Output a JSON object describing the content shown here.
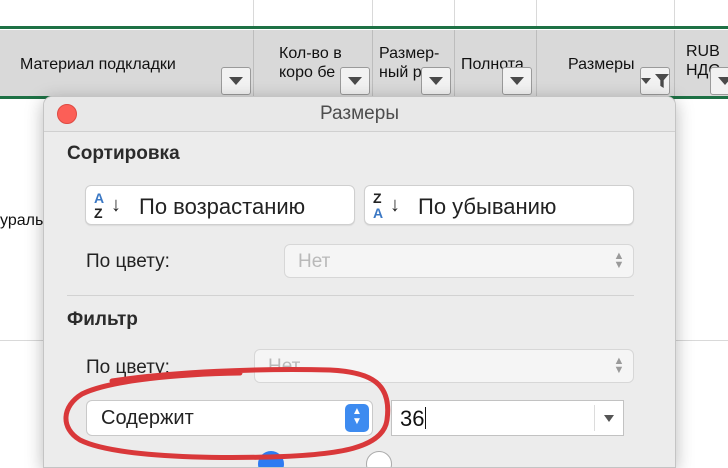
{
  "spreadsheet": {
    "headers": [
      {
        "label": "Материал подкладки",
        "button": "dropdown"
      },
      {
        "label": "Кол-во в\nкоро бе",
        "button": "dropdown"
      },
      {
        "label": "Размер-\nный р",
        "button": "dropdown"
      },
      {
        "label": "Полнота",
        "button": "dropdown"
      },
      {
        "label": "Размеры",
        "button": "filter-active"
      },
      {
        "label": "RUB\nНДС",
        "button": "dropdown"
      }
    ],
    "cell_text": "ураль"
  },
  "popup": {
    "title": "Размеры",
    "sort": {
      "heading": "Сортировка",
      "ascending_label": "По возрастанию",
      "ascending_icon": {
        "top": "A",
        "bottom": "Z",
        "arrow": "↓"
      },
      "descending_label": "По убыванию",
      "descending_icon": {
        "top": "Z",
        "bottom": "A",
        "arrow": "↓"
      },
      "by_color_label": "По цвету:",
      "by_color_value": "Нет"
    },
    "filter": {
      "heading": "Фильтр",
      "by_color_label": "По цвету:",
      "by_color_value": "Нет",
      "condition_value": "Содержит",
      "criteria_value": "36"
    }
  },
  "colors": {
    "header_bg": "#d9d9d9",
    "excel_green": "#1e7145",
    "close_red": "#fc5f57",
    "accent_blue": "#3d8bf0",
    "annotation_red": "#d9383a"
  }
}
